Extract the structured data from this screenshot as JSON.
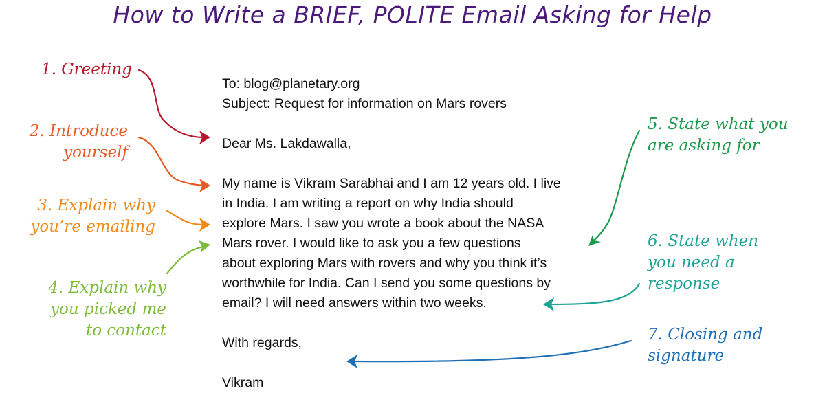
{
  "title": "How to Write a BRIEF, POLITE Email Asking for Help",
  "email": {
    "to": "To: blog@planetary.org",
    "subject": "Subject: Request for information on Mars rovers",
    "greeting": "Dear Ms. Lakdawalla,",
    "body_lines": [
      "My name is Vikram Sarabhai and I am 12 years old. I live",
      "in India. I am writing a report on why India should",
      "explore Mars. I saw you wrote a book about the NASA",
      "Mars rover. I would like to ask you a few questions",
      "about exploring Mars with rovers and why you think it’s",
      "worthwhile for India. Can I send you some questions by",
      "email? I will need answers within two weeks."
    ],
    "closing": "With regards,",
    "signature": "Vikram"
  },
  "annotations": [
    {
      "id": 1,
      "lines": [
        "1. Greeting"
      ],
      "color": "#b5172b"
    },
    {
      "id": 2,
      "lines": [
        "2. Introduce",
        "yourself"
      ],
      "color": "#e85a24"
    },
    {
      "id": 3,
      "lines": [
        "3. Explain why",
        "you’re emailing"
      ],
      "color": "#f08a1c"
    },
    {
      "id": 4,
      "lines": [
        "4. Explain why",
        "you picked me",
        "to contact"
      ],
      "color": "#7cbc3a"
    },
    {
      "id": 5,
      "lines": [
        "5. State what you",
        "are asking for"
      ],
      "color": "#1e9a4b"
    },
    {
      "id": 6,
      "lines": [
        "6. State when",
        "you need a",
        "response"
      ],
      "color": "#1fa394"
    },
    {
      "id": 7,
      "lines": [
        "7. Closing and",
        "signature"
      ],
      "color": "#1f6fb5"
    }
  ],
  "title_color": "#4b1a7a"
}
